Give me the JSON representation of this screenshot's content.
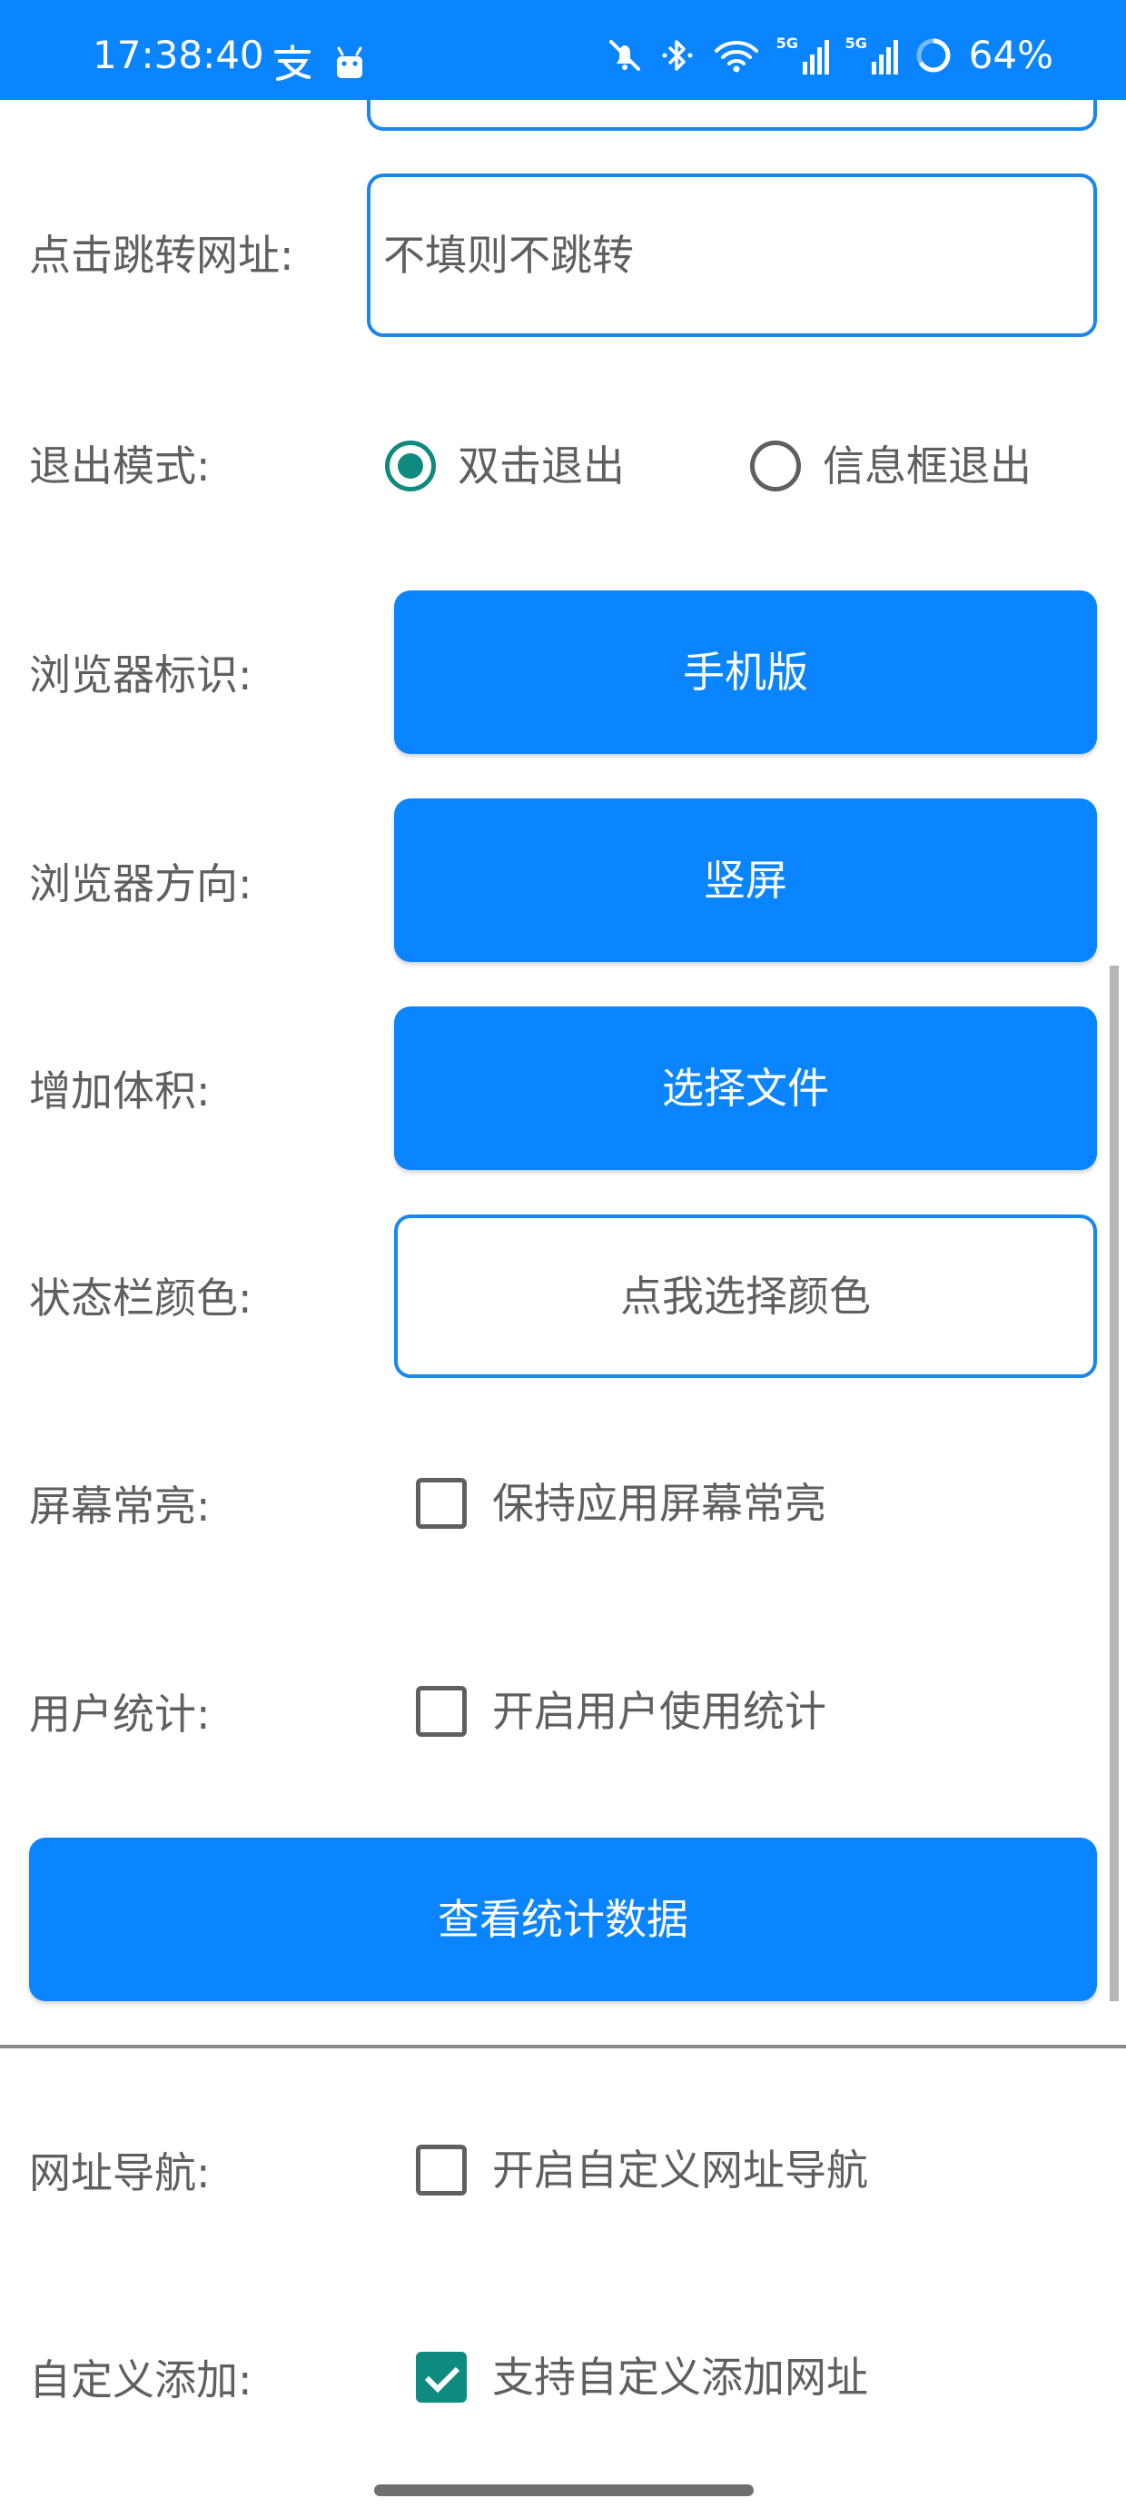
{
  "status_bar": {
    "time": "17:38:40",
    "battery": "64%",
    "signal_tag": "5G",
    "icons": [
      "alipay-icon",
      "android-icon",
      "mute-icon",
      "bluetooth-icon",
      "wifi-icon",
      "signal-icon",
      "signal-icon",
      "battery-ring-icon"
    ]
  },
  "form": {
    "jump_url": {
      "label": "点击跳转网址:",
      "placeholder": "不填则不跳转",
      "value": ""
    },
    "exit_mode": {
      "label": "退出模式:",
      "options": [
        "双击退出",
        "信息框退出"
      ],
      "selected": "双击退出"
    },
    "browser_id": {
      "label": "浏览器标识:",
      "button": "手机版"
    },
    "browser_orientation": {
      "label": "浏览器方向:",
      "button": "竖屏"
    },
    "add_size": {
      "label": "增加体积:",
      "button": "选择文件"
    },
    "status_color": {
      "label": "状态栏颜色:",
      "button": "点我选择颜色"
    },
    "screen_on": {
      "label": "屏幕常亮:",
      "checkbox": "保持应用屏幕常亮",
      "checked": false
    },
    "user_stats": {
      "label": "用户统计:",
      "checkbox": "开启用户使用统计",
      "checked": false
    },
    "view_stats_button": "查看统计数据",
    "url_nav": {
      "label": "网址导航:",
      "checkbox": "开启自定义网址导航",
      "checked": false
    },
    "custom_add": {
      "label": "自定义添加:",
      "checkbox": "支持自定义添加网址",
      "checked": true
    }
  },
  "colors": {
    "primary": "#0a84ff",
    "accent": "#0f8a7e",
    "outline": "#1a87ea",
    "text": "#5f5f5f"
  }
}
